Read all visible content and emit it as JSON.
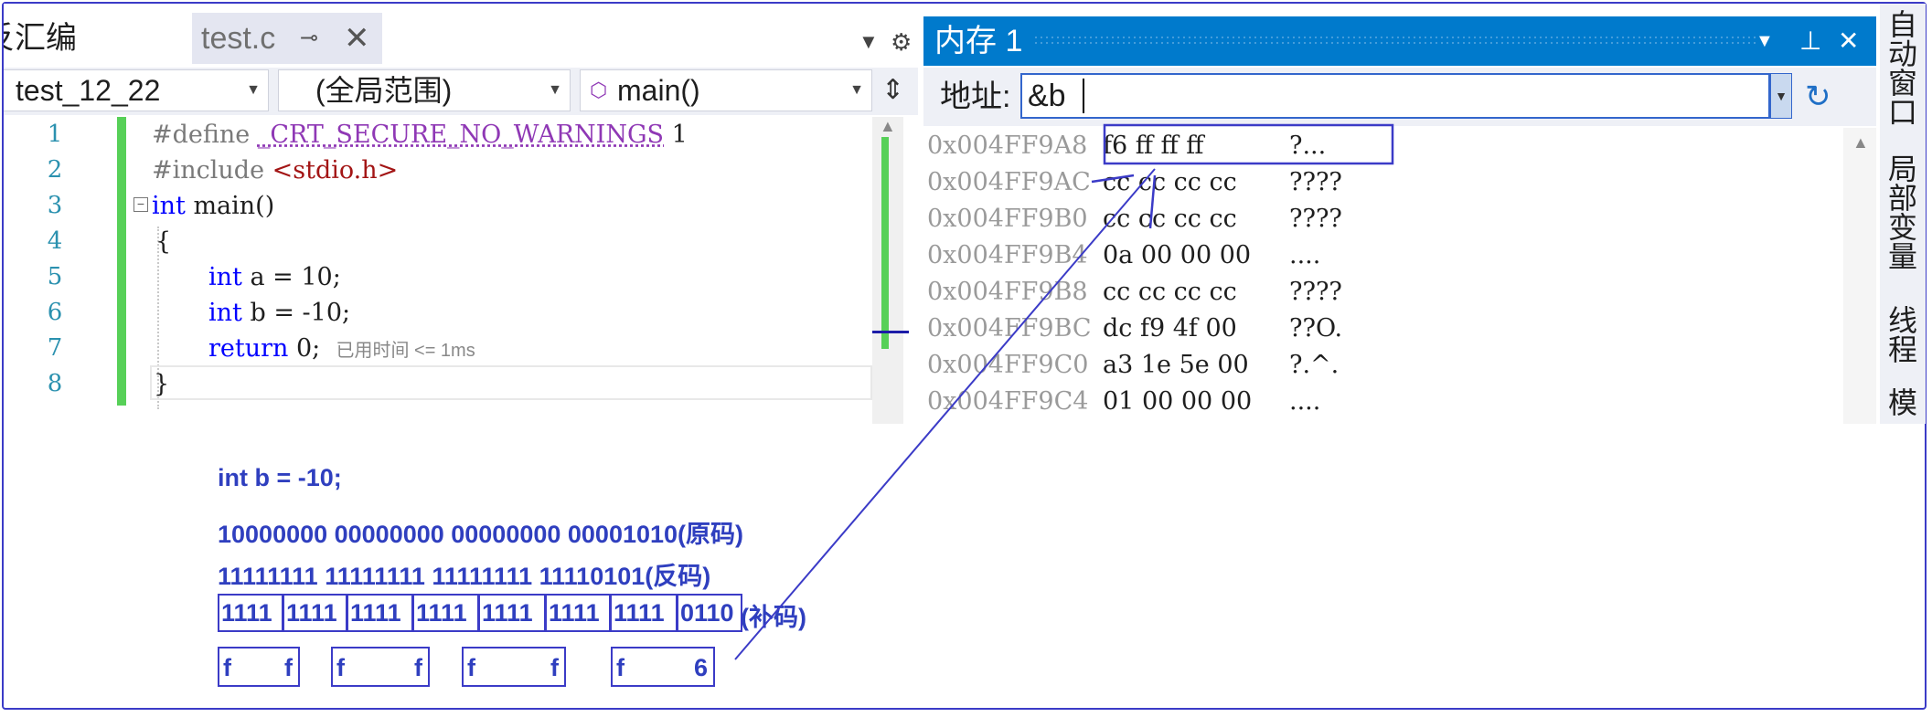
{
  "editor": {
    "tabs": {
      "prev_label": "反汇编",
      "active_label": "test.c",
      "pin_icon": "pin-icon",
      "close_icon": "close-icon"
    },
    "nav": {
      "project": "test_12_22",
      "scope": "(全局范围)",
      "function": "main()"
    },
    "line_numbers": [
      "1",
      "2",
      "3",
      "4",
      "5",
      "6",
      "7",
      "8"
    ],
    "code": {
      "l1_directive": "#define",
      "l1_macro": "_CRT_SECURE_NO_WARNINGS",
      "l1_value": "1",
      "l2_directive": "#include",
      "l2_header": "<stdio.h>",
      "l3_kw": "int",
      "l3_rest": " main()",
      "l4": "{",
      "l5_kw": "int",
      "l5_rest": " a = 10;",
      "l6_kw": "int",
      "l6_rest": " b = -10;",
      "l7_kw": "return",
      "l7_rest": " 0;",
      "l7_hint": "已用时间 <= 1ms",
      "l8": "}"
    }
  },
  "memory": {
    "title": "内存 1",
    "address_label": "地址:",
    "address_value": "&b",
    "rows": [
      {
        "addr": "0x004FF9A8",
        "hex": "f6 ff ff ff",
        "chars": "?..."
      },
      {
        "addr": "0x004FF9AC",
        "hex": "cc cc cc cc",
        "chars": "????"
      },
      {
        "addr": "0x004FF9B0",
        "hex": "cc cc cc cc",
        "chars": "????"
      },
      {
        "addr": "0x004FF9B4",
        "hex": "0a 00 00 00",
        "chars": "...."
      },
      {
        "addr": "0x004FF9B8",
        "hex": "cc cc cc cc",
        "chars": "????"
      },
      {
        "addr": "0x004FF9BC",
        "hex": "dc f9 4f 00",
        "chars": "??O."
      },
      {
        "addr": "0x004FF9C0",
        "hex": "a3 1e 5e 00",
        "chars": "?.^."
      },
      {
        "addr": "0x004FF9C4",
        "hex": "01 00 00 00",
        "chars": "...."
      }
    ]
  },
  "side_tabs": [
    "自动窗口",
    "局部变量",
    "线程",
    "模"
  ],
  "annotation": {
    "decl": "int b = -10;",
    "original": "10000000 00000000 00000000 00001010(原码)",
    "ones": "11111111 11111111 11111111 11110101(反码)",
    "twos_groups": [
      "1111",
      "1111",
      "1111",
      "1111",
      "1111",
      "1111",
      "1111",
      "0110"
    ],
    "twos_suffix": "(补码)",
    "nibbles": [
      "f",
      "f",
      "f",
      "f",
      "f",
      "f",
      "f",
      "6"
    ]
  },
  "colors": {
    "accent": "#007acc",
    "annotation": "#2f3fbf",
    "gutter_mark": "#57d058"
  }
}
